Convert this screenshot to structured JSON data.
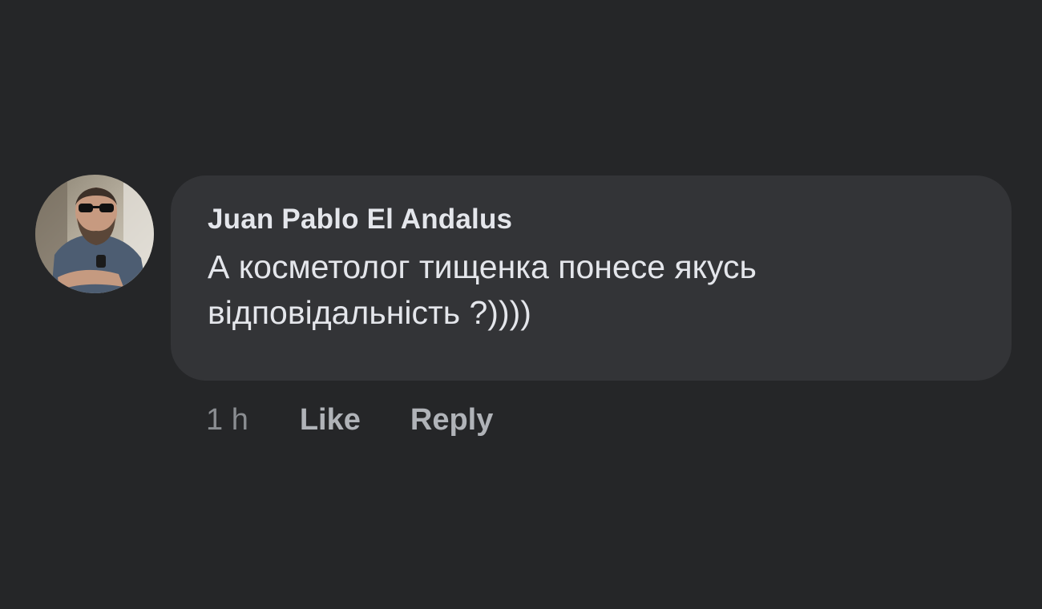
{
  "comment": {
    "author": "Juan Pablo El Andalus",
    "text": "А косметолог тищенка понесе якусь відповідальність ?))))",
    "timestamp": "1 h",
    "like_label": "Like",
    "reply_label": "Reply"
  },
  "colors": {
    "background": "#252628",
    "bubble": "#333437",
    "primary_text": "#e4e6eb",
    "secondary_text": "#b0b3b8"
  },
  "icons": {
    "avatar": "user-profile-photo"
  }
}
